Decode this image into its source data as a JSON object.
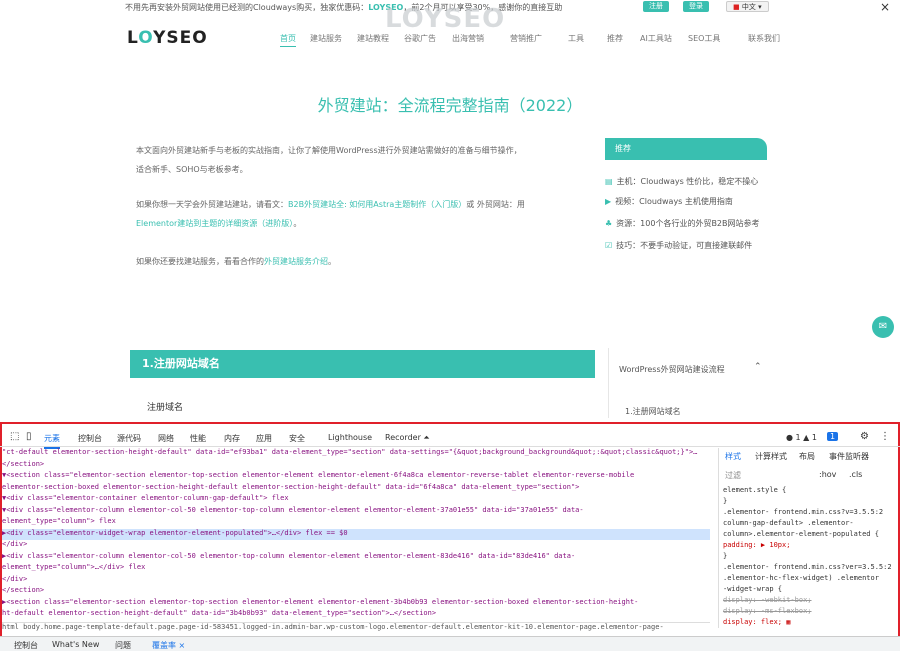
{
  "notice": {
    "text": "不用先再安装外贸网站使用已经测的Cloudways购买，独家优惠码：",
    "code": "LOYSEO",
    "tail": "，前2个月可以享受30%，感谢你的直接互助",
    "btn1": "注册",
    "btn2": "登录",
    "lang": "中文"
  },
  "watermark": "LOYSEO",
  "close": "×",
  "site": {
    "logo_pre": "L",
    "logo_o": "O",
    "logo_post": "YSEO"
  },
  "nav": [
    "首页",
    "建站服务",
    "建站教程",
    "谷歌广告",
    "出海营销",
    "营销推广",
    "工具",
    "推荐",
    "AI工具站",
    "SEO工具",
    "联系我们"
  ],
  "article": {
    "title": "外贸建站：全流程完整指南（2022）",
    "p1": "本文面向外贸建站新手与老板的实战指南，让你了解使用WordPress进行外贸建站需做好的准备与细节操作，",
    "p1b": "适合新手、SOHO与老板参考。",
    "p2a": "如果你想一天学会外贸建站建站，请看文：",
    "p2link": "B2B外贸建站全: 如何用Astra主题制作（入门版）",
    "p2b": "或 外贸网站：用",
    "p3link": "Elementor建站到主题的详细资源（进阶版）",
    "p3b": "。",
    "p4a": "如果你还要找建站服务，看看合作的",
    "p4link": "外贸建站服务介绍",
    "p4b": "。"
  },
  "sidebar": {
    "card": "推荐",
    "tips": [
      "主机：Cloudways 性价比，稳定不操心",
      "视频：Cloudways 主机使用指南",
      "资源：100个各行业的外贸B2B网站参考",
      "技巧：不要手动验证，可直接建联邮件"
    ]
  },
  "section": {
    "h1": "1.注册网站域名",
    "h2": "注册域名",
    "toc_title": "WordPress外贸网站建设流程",
    "toc_item": "1.注册网站域名"
  },
  "devtools": {
    "tabs": [
      "元素",
      "控制台",
      "源代码",
      "网络",
      "性能",
      "内存",
      "应用",
      "安全",
      "Lighthouse",
      "Recorder ⏶"
    ],
    "counts": "● 1  ▲ 1",
    "issues": "1",
    "lines": [
      "  \"ct-default elementor-section-height-default\" data-id=\"ef93ba1\" data-element_type=\"section\" data-settings=\"{&quot;background_background&quot;:&quot;classic&quot;}\">…",
      "  </section>",
      "▼<section class=\"elementor-section elementor-top-section elementor-element elementor-element-6f4a8ca elementor-reverse-tablet elementor-reverse-mobile",
      "   elementor-section-boxed elementor-section-height-default elementor-section-height-default\" data-id=\"6f4a8ca\" data-element_type=\"section\">",
      "   ▼<div class=\"elementor-container elementor-column-gap-default\"> flex",
      "     ▼<div class=\"elementor-column elementor-col-50 elementor-top-column elementor-element elementor-element-37a01e55\" data-id=\"37a01e55\" data-",
      "        element_type=\"column\"> flex",
      "       ▶<div class=\"elementor-widget-wrap elementor-element-populated\">…</div> flex == $0",
      "       </div>",
      "     ▶<div class=\"elementor-column elementor-col-50 elementor-top-column elementor-element elementor-element-83de416\" data-id=\"83de416\" data-",
      "        element_type=\"column\">…</div> flex",
      "     </div>",
      "   </section>",
      "▶<section class=\"elementor-section elementor-top-section elementor-element elementor-element-3b4b0b93 elementor-section-boxed elementor-section-height-",
      "   ht-default elementor-section-height-default\" data-id=\"3b4b0b93\" data-element_type=\"section\">…</section>"
    ],
    "styles_tabs": [
      "样式",
      "计算样式",
      "布局",
      "事件监听器"
    ],
    "filter": "过滤",
    "hov": ":hov",
    "cls": ".cls",
    "style_lines": [
      "element.style {",
      "}",
      ".elementor-        frontend.min.css?v=3.5.5:2",
      "column-gap-default> .elementor-",
      "column>.elementor-element-populated {",
      "  padding: ▶ 10px;",
      "}",
      ".elementor-       frontend.min.css?ver=3.5.5:2",
      ".elementor-hc-flex-widget) .elementor",
      "-widget-wrap {",
      "  display: -webkit-box;",
      "  display: -ms-flexbox;",
      "  display: flex; ▦"
    ],
    "breadcrumbs": "html  body.home.page-template-default.page.page-id-583451.logged-in.admin-bar.wp-custom-logo.elementor-default.elementor-kit-10.elementor-page.elementor-page-",
    "drawer": [
      "控制台",
      "What's New",
      "问题",
      "覆盖率 ×"
    ]
  }
}
